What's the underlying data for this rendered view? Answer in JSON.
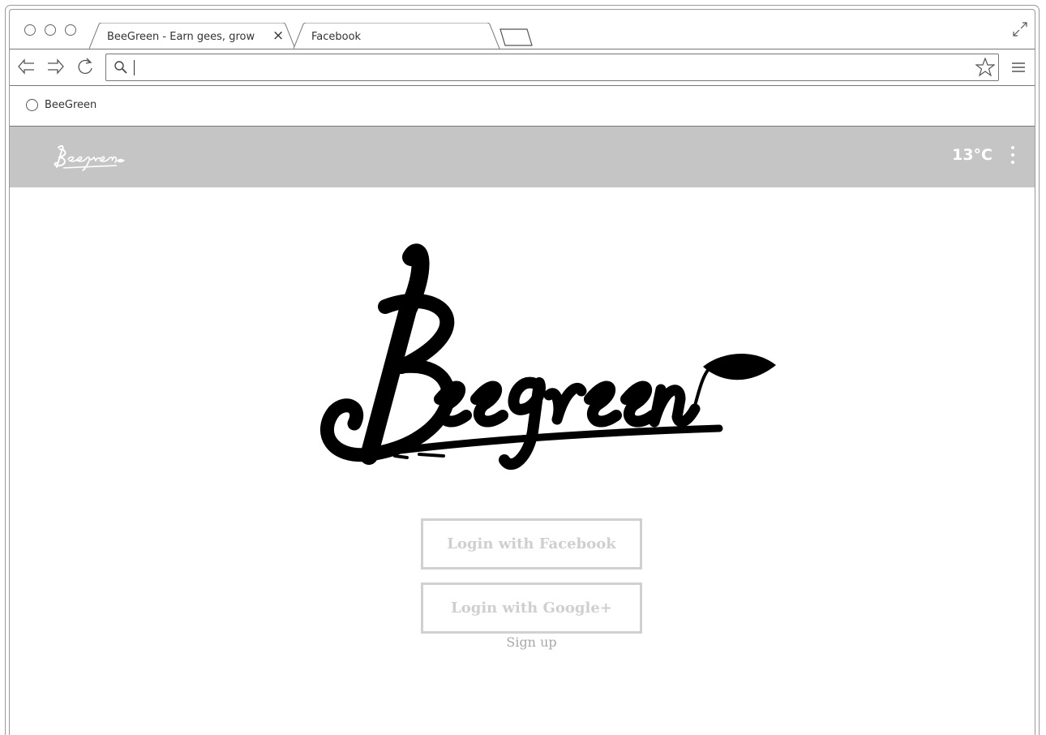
{
  "browser": {
    "tabs": [
      {
        "title": "BeeGreen - Earn gees, grow",
        "close_label": "×",
        "active": true
      },
      {
        "title": "Facebook",
        "active": false
      }
    ],
    "address": {
      "value": "",
      "placeholder": ""
    },
    "bookmarks": [
      {
        "label": "BeeGreen"
      }
    ]
  },
  "app": {
    "brand": "Beegreen",
    "temperature": "13°C",
    "menu_icon": "kebab-menu-icon"
  },
  "login": {
    "facebook_label": "Login with Facebook",
    "google_label": "Login with Google+",
    "signup_label": "Sign up"
  },
  "colors": {
    "appbar": "#c4c5c4",
    "button_border": "#d0d0d0",
    "button_text": "#cfcfcf"
  }
}
